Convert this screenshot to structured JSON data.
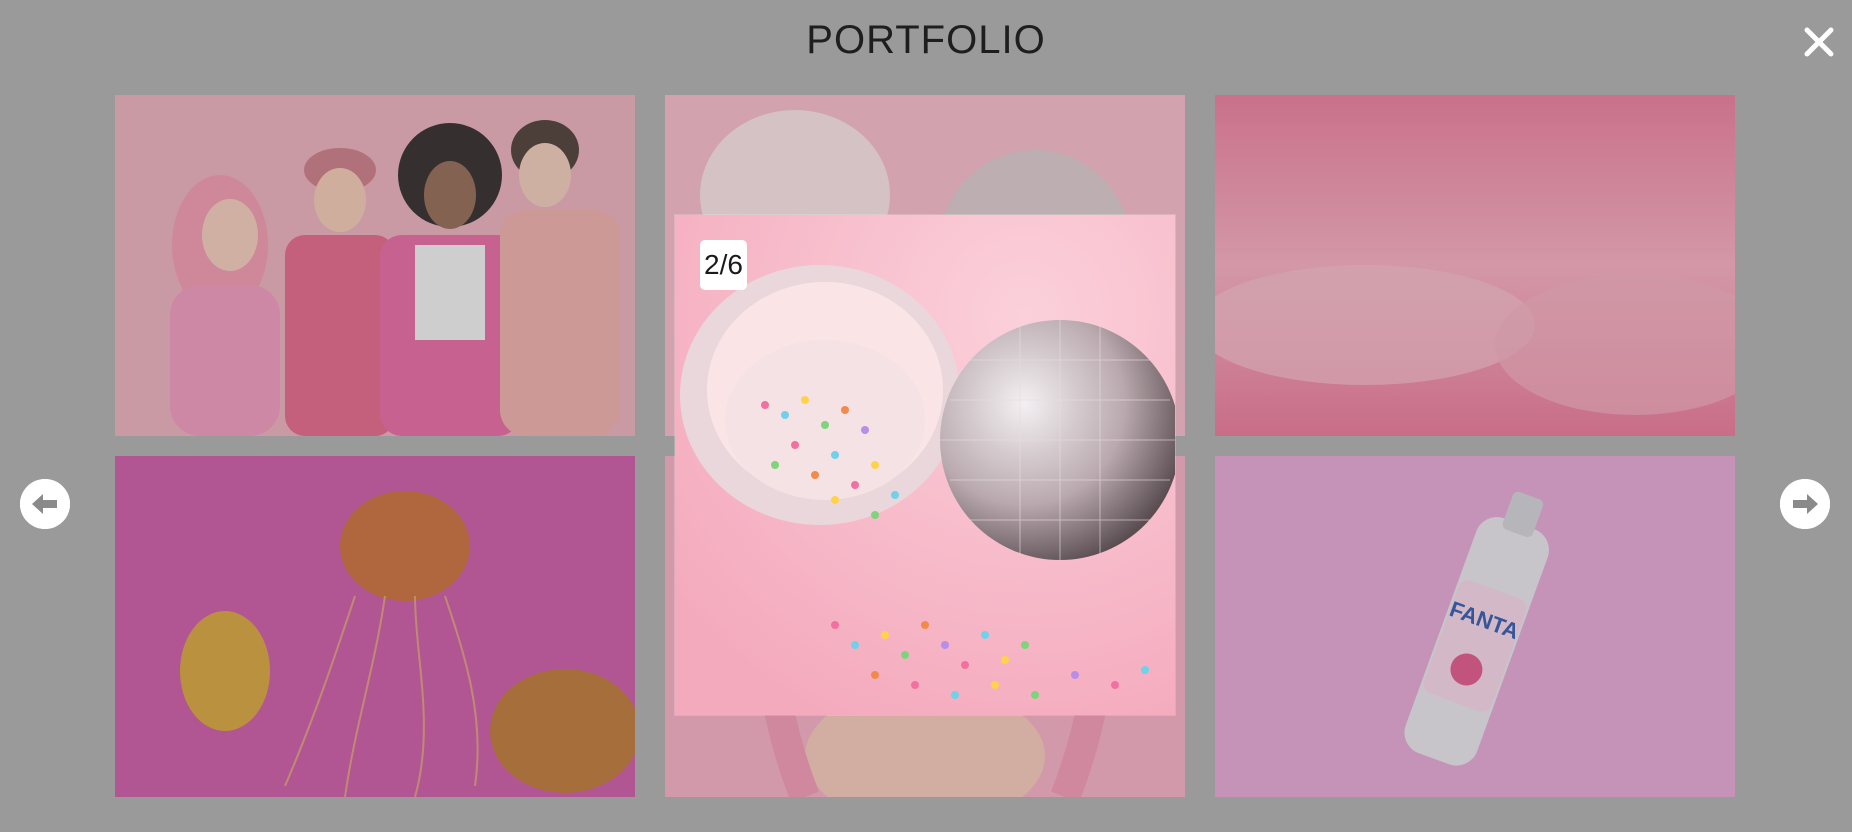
{
  "header": {
    "title": "PORTFOLIO"
  },
  "icons": {
    "close": "close-icon",
    "prev": "arrow-left-icon",
    "next": "arrow-right-icon"
  },
  "gallery": {
    "tiles": [
      {
        "name": "people-photo"
      },
      {
        "name": "disco-sprinkles-photo"
      },
      {
        "name": "pink-fur-photo"
      },
      {
        "name": "jellyfish-photo"
      },
      {
        "name": "pink-hair-photo"
      },
      {
        "name": "fanta-bottle-photo"
      }
    ]
  },
  "lightbox": {
    "counter": "2/6"
  },
  "colors": {
    "overlay": "#9a9a9a",
    "accent_pink": "#e89aae"
  }
}
